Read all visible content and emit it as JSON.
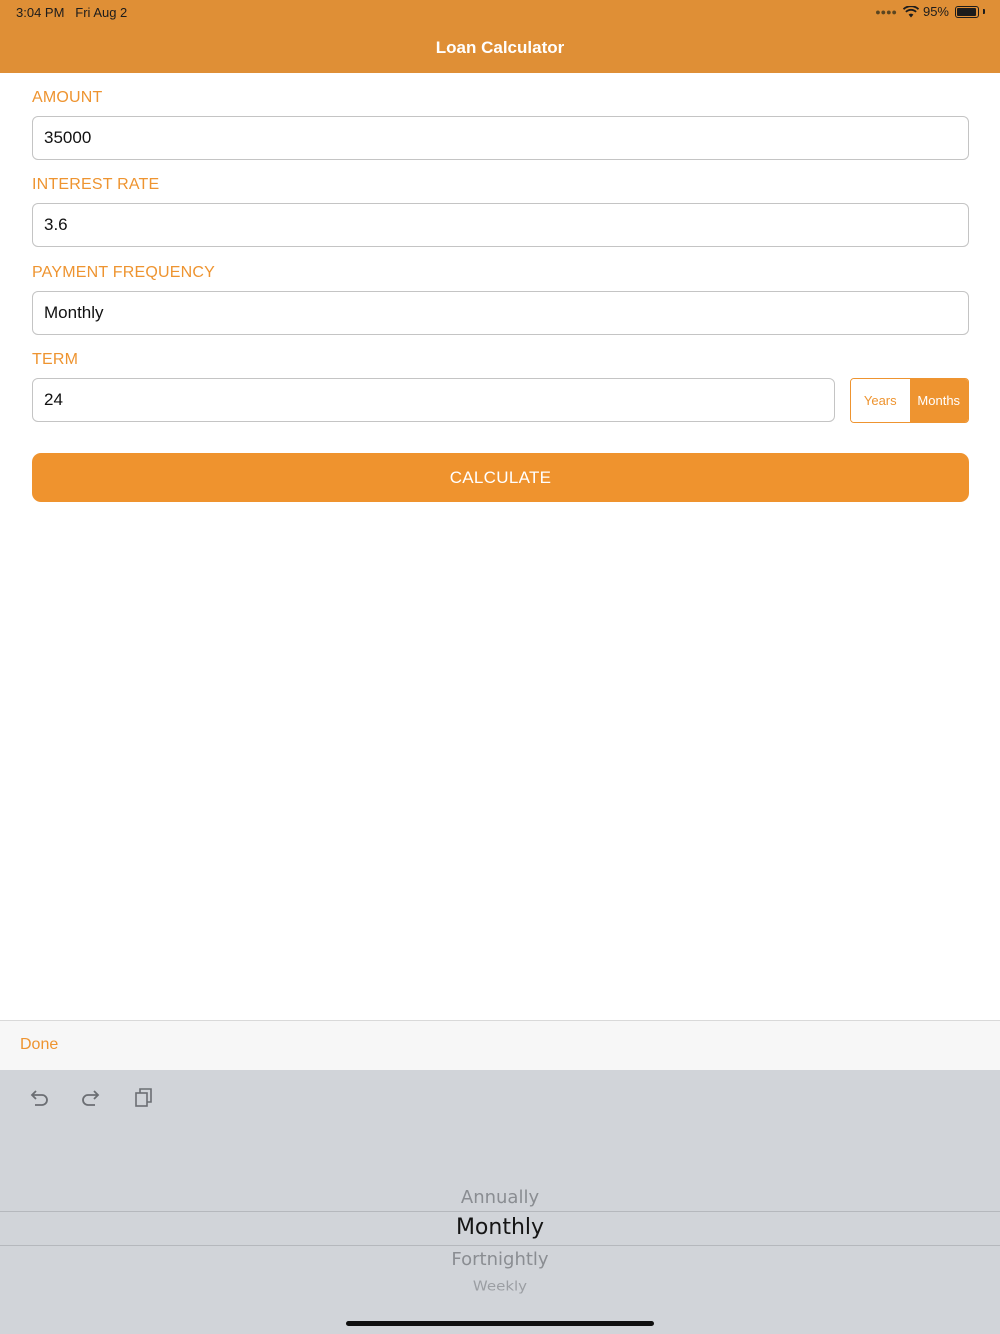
{
  "status_bar": {
    "time": "3:04 PM",
    "date": "Fri Aug 2",
    "battery": "95%",
    "battery_level": 0.95
  },
  "nav": {
    "title": "Loan Calculator"
  },
  "form": {
    "amount": {
      "label": "AMOUNT",
      "value": "35000"
    },
    "interest_rate": {
      "label": "INTEREST RATE",
      "value": "3.6"
    },
    "payment_frequency": {
      "label": "PAYMENT FREQUENCY",
      "value": "Monthly"
    },
    "term": {
      "label": "TERM",
      "value": "24"
    },
    "term_unit": {
      "options": [
        "Years",
        "Months"
      ],
      "selected": "Months"
    },
    "calculate_label": "CALCULATE"
  },
  "keyboard_toolbar": {
    "done_label": "Done"
  },
  "shortcut_icons": [
    "undo-icon",
    "redo-icon",
    "paste-icon"
  ],
  "picker": {
    "items": [
      "Annually",
      "Monthly",
      "Fortnightly",
      "Weekly"
    ],
    "selected": "Monthly"
  },
  "colors": {
    "accent": "#ef932e",
    "header": "#df8f36",
    "keyboard_bg": "#d1d4d9"
  }
}
